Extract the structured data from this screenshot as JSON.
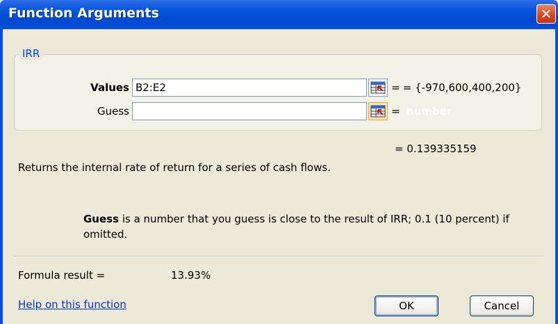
{
  "window": {
    "title": "Function Arguments"
  },
  "group": {
    "label": "IRR"
  },
  "args": [
    {
      "label": "Values",
      "value": "B2:E2",
      "result": "= {-970,600,400,200}",
      "bold": true
    },
    {
      "label": "Guess",
      "value": "",
      "result": "number",
      "bold": false
    }
  ],
  "equals_sign": "=",
  "result_top": "= 0.139335159",
  "description": "Returns the internal rate of return for a series of cash flows.",
  "guess_help": {
    "name": "Guess",
    "text": "is a number that you guess is close to the result of IRR; 0.1 (10 percent) if omitted."
  },
  "formula": {
    "label": "Formula result =",
    "value": "13.93%"
  },
  "help_link": "Help on this function",
  "buttons": {
    "ok": "OK",
    "cancel": "Cancel"
  },
  "icons": {
    "close": "close-icon",
    "ref": "range-select-icon"
  },
  "colors": {
    "titlebar": "#0049d3",
    "group_label": "#0046d5",
    "link": "#0033cc",
    "close": "#d7431d"
  }
}
